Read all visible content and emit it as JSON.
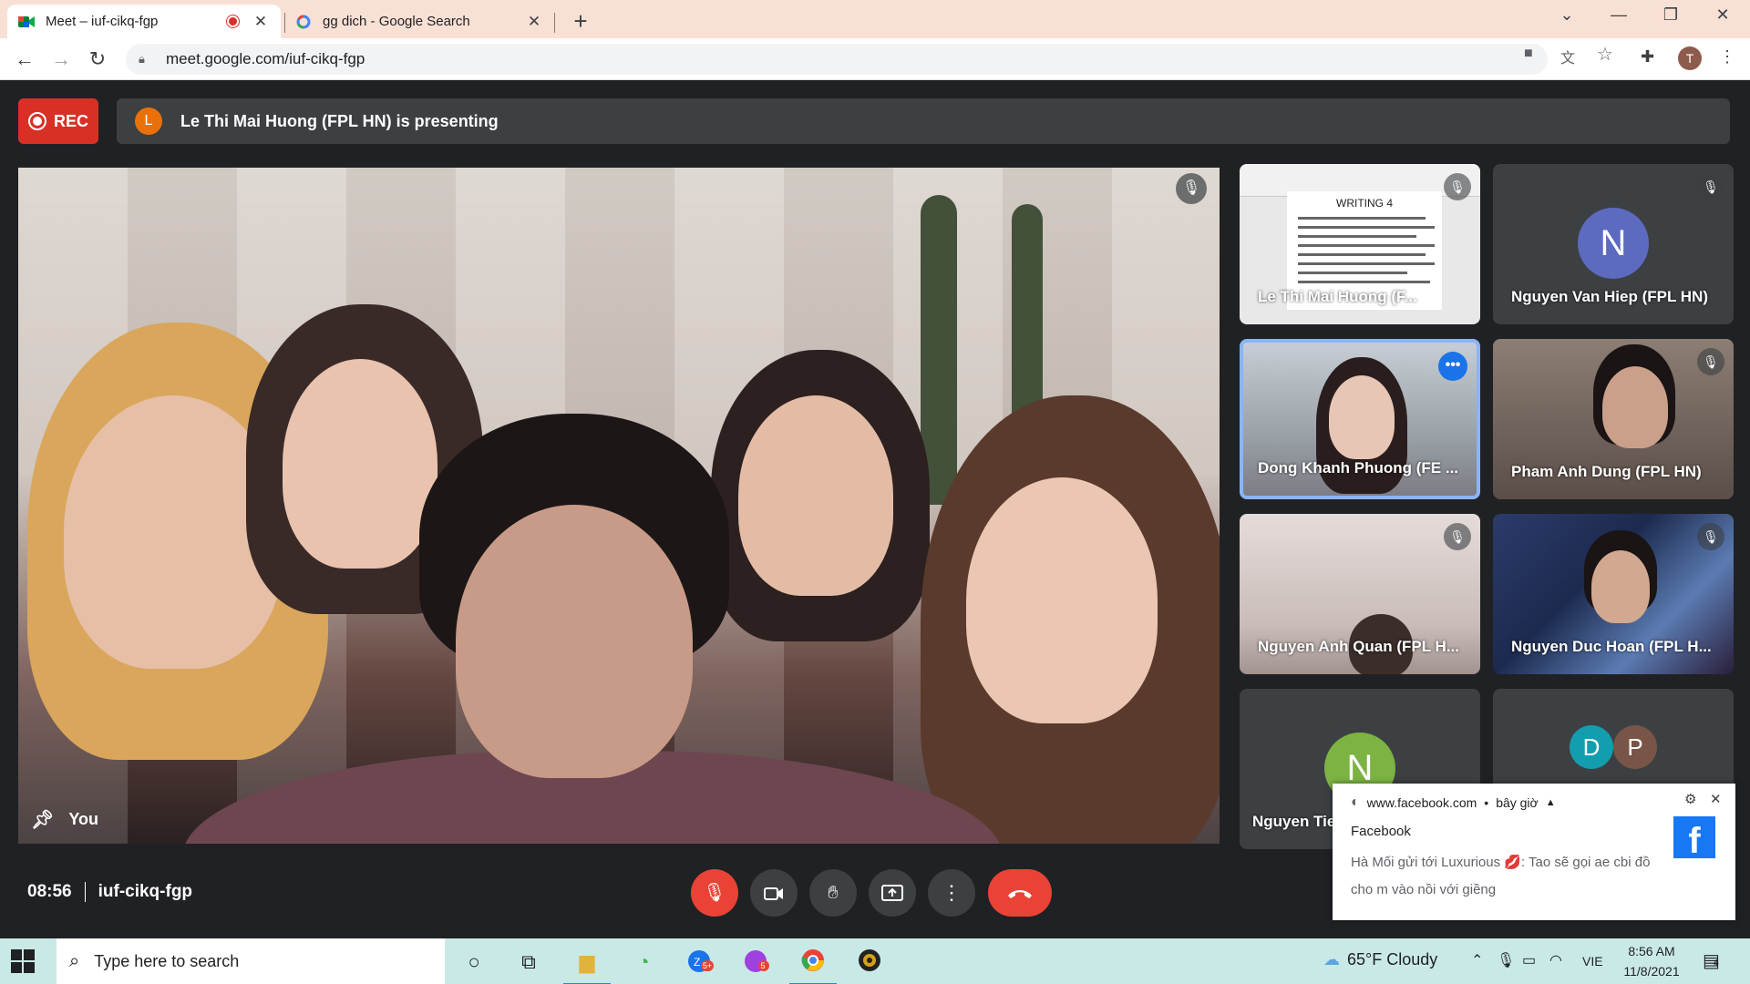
{
  "browser": {
    "tabs": [
      {
        "title": "Meet – iuf-cikq-fgp",
        "active": true
      },
      {
        "title": "gg dich - Google Search",
        "active": false
      }
    ],
    "url": "meet.google.com/iuf-cikq-fgp",
    "profile_initial": "T"
  },
  "meet": {
    "rec_label": "REC",
    "presenter_initial": "L",
    "presenting_text": "Le Thi Mai Huong (FPL HN) is presenting",
    "self_label": "You",
    "tiles": [
      {
        "name": "Le Thi Mai Huong (F...",
        "type": "presentation",
        "slide_title": "WRITING 4"
      },
      {
        "name": "Nguyen Van Hiep (FPL HN)",
        "initial": "N",
        "color": "#5c6bc0"
      },
      {
        "name": "Dong Khanh Phuong (FE ...",
        "type": "video",
        "highlight": true
      },
      {
        "name": "Pham Anh Dung (FPL HN)",
        "type": "video"
      },
      {
        "name": "Nguyen Anh Quan (FPL H...",
        "type": "video"
      },
      {
        "name": "Nguyen Duc Hoan (FPL H...",
        "type": "video"
      },
      {
        "name": "Nguyen Tie",
        "initial": "N",
        "color": "#7cb342"
      },
      {
        "avatars": [
          {
            "initial": "D",
            "color": "#129eaf"
          },
          {
            "initial": "P",
            "color": "#795548"
          }
        ]
      }
    ],
    "time": "08:56",
    "meeting_code": "iuf-cikq-fgp"
  },
  "notification": {
    "source": "www.facebook.com",
    "time": "bây giờ",
    "app": "Facebook",
    "message": "Hà Mối gửi tới Luxurious 💋: Tao sẽ gọi ae cbi đồ cho m vào nồi với giềng"
  },
  "taskbar": {
    "search_placeholder": "Type here to search",
    "weather": "65°F  Cloudy",
    "lang": "VIE",
    "time": "8:56 AM",
    "date": "11/8/2021",
    "badge_zalo": "5+",
    "badge_messenger": "5",
    "notif_count": "4"
  },
  "colors": {
    "meet_bg": "#202124",
    "rec_red": "#d93025",
    "tab_bar": "#f9e0d4",
    "taskbar": "#c9e9e7"
  }
}
